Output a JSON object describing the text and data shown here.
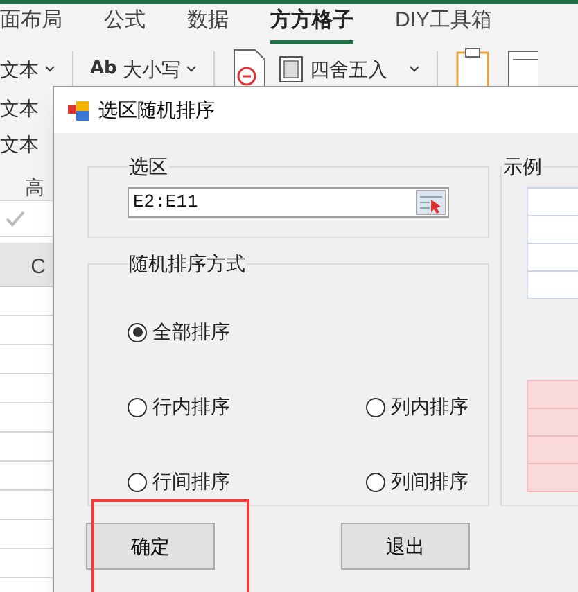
{
  "ribbon": {
    "tabs": [
      {
        "label": "面布局",
        "selected": false
      },
      {
        "label": "公式",
        "selected": false
      },
      {
        "label": "数据",
        "selected": false
      },
      {
        "label": "方方格子",
        "selected": true
      },
      {
        "label": "DIY工具箱",
        "selected": false
      }
    ],
    "row_1": [
      {
        "kind": "dropdown",
        "label": "文本"
      },
      {
        "kind": "divider"
      },
      {
        "kind": "case",
        "icon_text": "Ab",
        "label": "大小写"
      },
      {
        "kind": "divider"
      },
      {
        "kind": "doc"
      },
      {
        "kind": "round",
        "label": "四舍五入"
      },
      {
        "kind": "divider"
      },
      {
        "kind": "clipboard"
      },
      {
        "kind": "panel"
      }
    ],
    "left_items": [
      "文本",
      "文本"
    ],
    "group_label": "高"
  },
  "sheet": {
    "column_header": "C"
  },
  "dialog": {
    "title": "选区随机排序",
    "selection_group": {
      "label": "选区",
      "value": "E2:E11"
    },
    "mode_group": {
      "label": "随机排序方式",
      "options": [
        {
          "label": "全部排序",
          "selected": true
        },
        {
          "label": "行内排序",
          "selected": false
        },
        {
          "label": "列内排序",
          "selected": false
        },
        {
          "label": "行间排序",
          "selected": false
        },
        {
          "label": "列间排序",
          "selected": false
        }
      ]
    },
    "example_group": {
      "label": "示例"
    },
    "buttons": [
      "确定",
      "退出"
    ]
  }
}
